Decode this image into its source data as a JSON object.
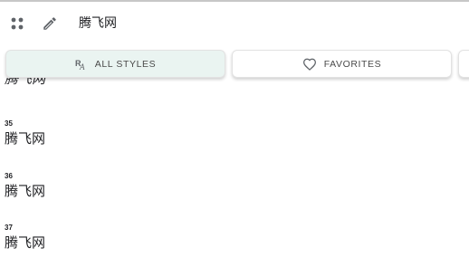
{
  "header": {
    "preview_text": "腾飞网"
  },
  "tabs": [
    {
      "label": "ALL STYLES",
      "icon": "font-styles-icon",
      "selected": true
    },
    {
      "label": "FAVORITES",
      "icon": "heart-icon",
      "selected": false
    }
  ],
  "styles": [
    {
      "weight": "35",
      "sample": "腾飞网"
    },
    {
      "weight": "36",
      "sample": "腾飞网"
    },
    {
      "weight": "37",
      "sample": "腾飞网"
    }
  ],
  "clipped_sample": "腾飞网",
  "colors": {
    "selected_tab_bg": "#eaf4f1",
    "text": "#202124"
  }
}
